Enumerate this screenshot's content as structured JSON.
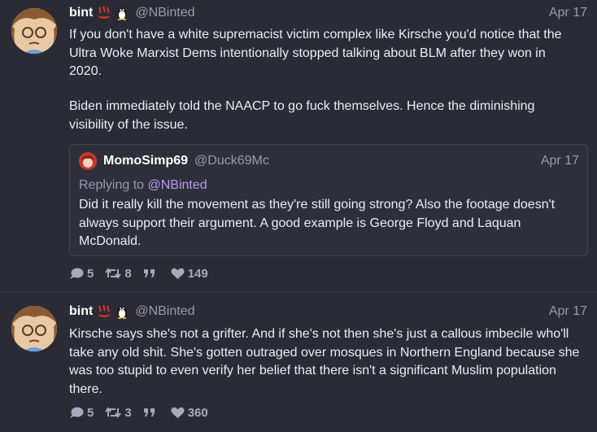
{
  "posts": [
    {
      "author": "bint",
      "handle": "@NBinted",
      "date": "Apr 17",
      "paragraphs": [
        "If you don't have a white supremacist victim complex like Kirsche you'd notice that the Ultra Woke Marxist Dems intentionally stopped talking about BLM after they won in 2020.",
        "Biden immediately told the NAACP to go fuck themselves. Hence the diminishing visibility of the issue."
      ],
      "quote": {
        "author": "MomoSimp69",
        "handle": "@Duck69Mc",
        "date": "Apr 17",
        "replying_prefix": "Replying to ",
        "replying_handle": "@NBinted",
        "text": "Did it really kill the movement as they're still going strong? Also the footage doesn't always support their argument. A good example is George Floyd and Laquan McDonald."
      },
      "replies": "5",
      "reposts": "8",
      "likes": "149"
    },
    {
      "author": "bint",
      "handle": "@NBinted",
      "date": "Apr 17",
      "text": "Kirsche says she's not a grifter. And if she's not then she's just a callous imbecile who'll take any old shit. She's gotten outraged over mosques in Northern England because she was too stupid to even verify her belief that there isn't a significant Muslim population there.",
      "replies": "5",
      "reposts": "3",
      "likes": "360"
    }
  ],
  "icons": {
    "reply": "speech-bubble-icon",
    "repost": "repost-arrows-icon",
    "quote": "quote-marks-icon",
    "like": "heart-icon",
    "emoji1": "hot-springs-icon",
    "emoji2": "penguin-icon"
  },
  "colors": {
    "background": "#2b2b36",
    "mention": "#b99af0",
    "muted": "#9a9aae",
    "emoji_red": "#e0332b"
  }
}
